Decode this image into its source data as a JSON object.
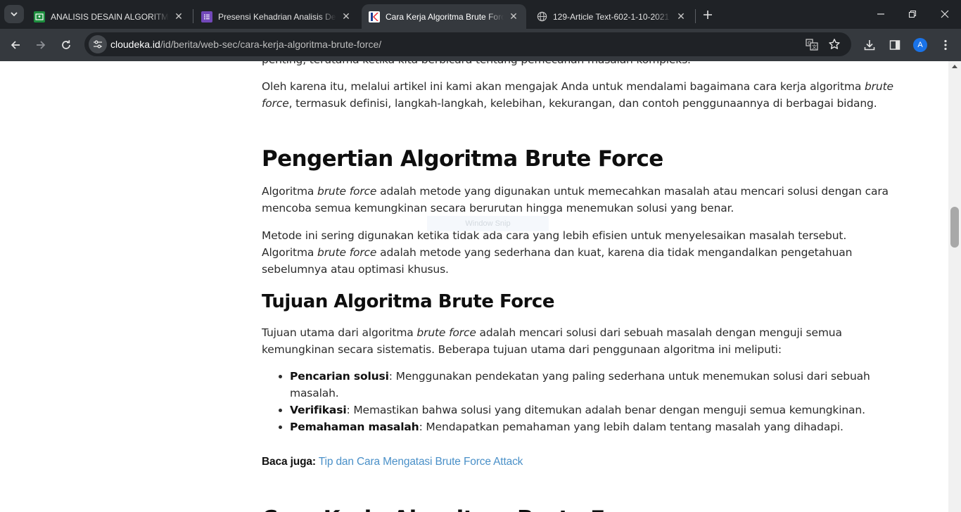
{
  "browser": {
    "tabs": [
      {
        "title": "ANALISIS DESAIN ALGORITMA (",
        "favicon": "google-classroom-icon",
        "favicon_color": "#1e8e3e",
        "active": false
      },
      {
        "title": "Presensi Kehadrian Analisis Des",
        "favicon": "google-forms-icon",
        "favicon_color": "#7248b9",
        "active": false
      },
      {
        "title": "Cara Kerja Algoritma Brute Forc",
        "favicon": "cloudeka-icon",
        "favicon_color": "#e8262c",
        "active": true
      },
      {
        "title": "129-Article Text-602-1-10-2021",
        "favicon": "globe-icon",
        "favicon_color": "#c7c7c7",
        "active": false
      }
    ],
    "url_host": "cloudeka.id",
    "url_path": "/id/berita/web-sec/cara-kerja-algoritma-brute-force/",
    "profile_initial": "A",
    "colors": {
      "tabstrip": "#1f2226",
      "toolbar": "#35393e",
      "omnibox": "#1f2226",
      "link": "#4a90c8",
      "profile": "#1a73e8"
    }
  },
  "article": {
    "intro_fragment": "penting, terutama ketika kita berbicara tentang pemecahan masalah kompleks.",
    "intro_p2": {
      "a": "Oleh karena itu, melalui artikel ini kami akan mengajak Anda untuk mendalami bagaimana cara kerja algoritma ",
      "em": "brute force",
      "b": ", termasuk definisi, langkah-langkah, kelebihan, kekurangan, dan contoh penggunaannya di berbagai bidang."
    },
    "h_pengertian": "Pengertian Algoritma Brute Force",
    "pengertian_p1": {
      "a": "Algoritma ",
      "em": "brute force",
      "b": " adalah metode yang digunakan untuk memecahkan masalah atau mencari solusi dengan cara mencoba semua kemungkinan secara berurutan hingga menemukan solusi yang benar."
    },
    "pengertian_p2": {
      "a": "Metode ini sering digunakan ketika tidak ada cara yang lebih efisien untuk menyelesaikan masalah tersebut. Algoritma ",
      "em": "brute force",
      "b": " adalah metode yang sederhana dan kuat, karena dia tidak mengandalkan pengetahuan sebelumnya atau optimasi khusus."
    },
    "h_tujuan": "Tujuan Algoritma Brute Force",
    "tujuan_p1": {
      "a": "Tujuan utama dari algoritma ",
      "em": "brute force",
      "b": " adalah mencari solusi dari sebuah masalah dengan menguji semua kemungkinan secara sistematis. Beberapa tujuan utama dari penggunaan algoritma ini meliputi:"
    },
    "tujuan_list": [
      {
        "term": "Pencarian solusi",
        "desc": ": Menggunakan pendekatan yang paling sederhana untuk menemukan solusi dari sebuah masalah."
      },
      {
        "term": "Verifikasi",
        "desc": ": Memastikan bahwa solusi yang ditemukan adalah benar dengan menguji semua kemungkinan."
      },
      {
        "term": "Pemahaman masalah",
        "desc": ": Mendapatkan pemahaman yang lebih dalam tentang masalah yang dihadapi."
      }
    ],
    "baca_label": "Baca juga:",
    "baca_link": "Tip dan Cara Mengatasi Brute Force Attack",
    "h_cara_kerja": "Cara Kerja Algoritma Brute Force"
  },
  "overlay": {
    "ghost_label": "Window Snip"
  }
}
